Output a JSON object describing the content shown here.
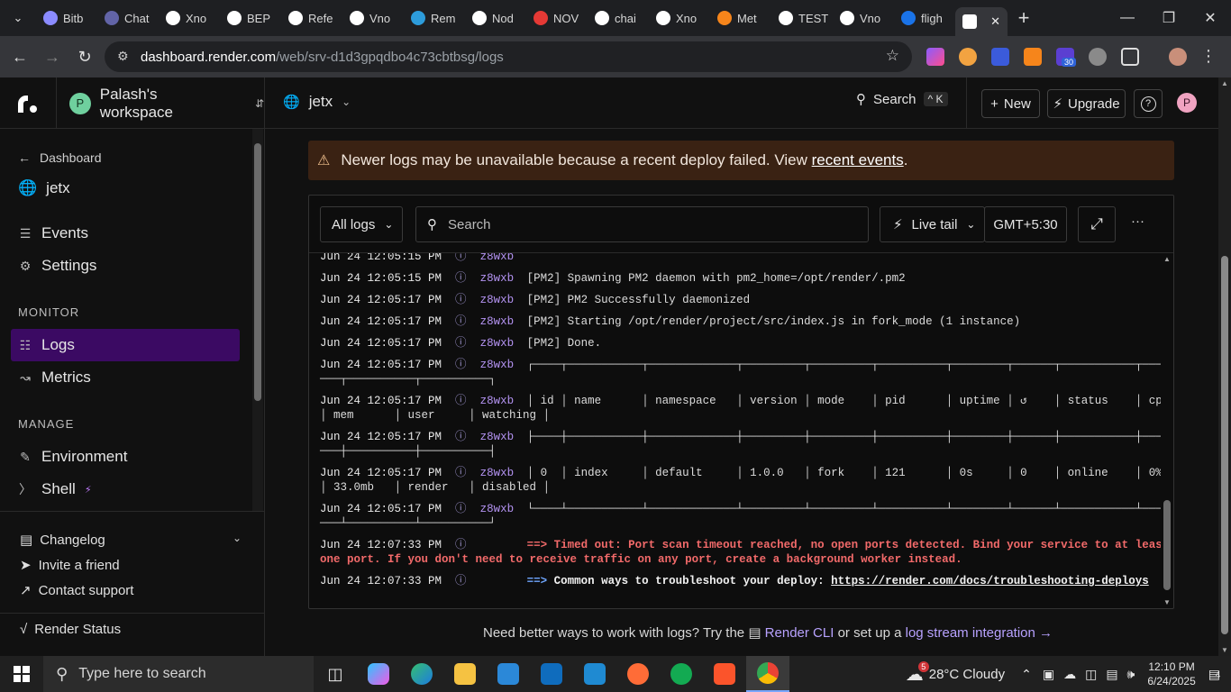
{
  "browser": {
    "tabs": [
      {
        "label": "Bitb",
        "color": "#8b8bff"
      },
      {
        "label": "Chat",
        "color": "#6264a7"
      },
      {
        "label": "Xno",
        "color": "#ffffff"
      },
      {
        "label": "BEP",
        "color": "#ffffff"
      },
      {
        "label": "Refe",
        "color": "#ffffff"
      },
      {
        "label": "Vno",
        "color": "#ffffff"
      },
      {
        "label": "Rem",
        "color": "#2d9cdb"
      },
      {
        "label": "Nod",
        "color": "#ffffff"
      },
      {
        "label": "NOV",
        "color": "#e53935"
      },
      {
        "label": "chai",
        "color": "#ffffff"
      },
      {
        "label": "Xno",
        "color": "#ffffff"
      },
      {
        "label": "Met",
        "color": "#f6851b"
      },
      {
        "label": "TEST",
        "color": "#ffffff"
      },
      {
        "label": "Vno",
        "color": "#ffffff"
      },
      {
        "label": "fligh",
        "color": "#1a73e8"
      }
    ],
    "active_tab_label": "",
    "url_host": "dashboard.render.com",
    "url_path": "/web/srv-d1d3gpqdbo4c73cbtbsg/logs",
    "extension_badge": "30"
  },
  "header": {
    "workspace_initial": "P",
    "workspace_name": "Palash's workspace",
    "project_name": "jetx",
    "search_label": "Search",
    "search_kbd": "^ K",
    "new_label": "New",
    "upgrade_label": "Upgrade",
    "help_label": "?",
    "user_initial": "P"
  },
  "sidebar": {
    "back_label": "Dashboard",
    "service_name": "jetx",
    "items_top": [
      {
        "label": "Events"
      },
      {
        "label": "Settings"
      }
    ],
    "monitor_heading": "MONITOR",
    "monitor_items": [
      {
        "label": "Logs"
      },
      {
        "label": "Metrics"
      }
    ],
    "manage_heading": "MANAGE",
    "manage_items": [
      {
        "label": "Environment"
      },
      {
        "label": "Shell"
      }
    ],
    "bottom": {
      "changelog": "Changelog",
      "invite": "Invite a friend",
      "support": "Contact support",
      "status": "Render Status"
    }
  },
  "main": {
    "warning_text": "Newer logs may be unavailable because a recent deploy failed. View",
    "warning_link": "recent events",
    "warning_end": ".",
    "toolbar": {
      "filter_label": "All logs",
      "search_placeholder": "Search",
      "live_tail_label": "Live tail",
      "timezone_label": "GMT+5:30",
      "more_label": "···"
    },
    "logs": [
      {
        "ts": "Jun 24 12:05:15 PM",
        "inst": "z8wxb",
        "msg": "",
        "cls": ""
      },
      {
        "ts": "Jun 24 12:05:15 PM",
        "inst": "z8wxb",
        "msg": "[PM2] Spawning PM2 daemon with pm2_home=/opt/render/.pm2",
        "cls": ""
      },
      {
        "ts": "Jun 24 12:05:17 PM",
        "inst": "z8wxb",
        "msg": "[PM2] PM2 Successfully daemonized",
        "cls": ""
      },
      {
        "ts": "Jun 24 12:05:17 PM",
        "inst": "z8wxb",
        "msg": "[PM2] Starting /opt/render/project/src/index.js in fork_mode (1 instance)",
        "cls": ""
      },
      {
        "ts": "Jun 24 12:05:17 PM",
        "inst": "z8wxb",
        "msg": "[PM2] Done.",
        "cls": ""
      },
      {
        "ts": "Jun 24 12:05:17 PM",
        "inst": "z8wxb",
        "msg": "┌────┬───────────┬─────────────┬─────────┬─────────┬──────────┬────────┬──────┬───────────┬──────────┬──────",
        "msg2": "───┬──────────┬──────────┐",
        "cls": ""
      },
      {
        "ts": "Jun 24 12:05:17 PM",
        "inst": "z8wxb",
        "msg": "│ id │ name      │ namespace   │ version │ mode    │ pid      │ uptime │ ↺    │ status    │ cpu",
        "msg2": "│ mem      │ user     │ watching │",
        "cls": ""
      },
      {
        "ts": "Jun 24 12:05:17 PM",
        "inst": "z8wxb",
        "msg": "├────┼───────────┼─────────────┼─────────┼─────────┼──────────┼────────┼──────┼───────────┼──────────┼──────",
        "msg2": "───┼──────────┼──────────┤",
        "cls": ""
      },
      {
        "ts": "Jun 24 12:05:17 PM",
        "inst": "z8wxb",
        "msg": "│ 0  │ index     │ default     │ 1.0.0   │ fork    │ 121      │ 0s     │ 0    │ online    │ 0%",
        "msg2": "│ 33.0mb   │ render   │ disabled │",
        "cls": ""
      },
      {
        "ts": "Jun 24 12:05:17 PM",
        "inst": "z8wxb",
        "msg": "└────┴───────────┴─────────────┴─────────┴─────────┴──────────┴────────┴──────┴───────────┴──────────┴──────",
        "msg2": "───┴──────────┴──────────┘",
        "cls": ""
      },
      {
        "ts": "Jun 24 12:07:33 PM",
        "inst": "",
        "msg": "==> Timed out: Port scan timeout reached, no open ports detected. Bind your service to at least",
        "msg2": "one port. If you don't need to receive traffic on any port, create a background worker instead.",
        "cls": "err"
      },
      {
        "ts": "Jun 24 12:07:33 PM",
        "inst": "",
        "msg_arrow": "==>",
        "msg": "Common ways to troubleshoot your deploy: ",
        "msg_link": "https://render.com/docs/troubleshooting-deploys",
        "cls": "tip"
      }
    ],
    "footer": {
      "text1": "Need better ways to work with logs? Try the",
      "cli_link": "Render CLI",
      "text2": "or set up a",
      "stream_link": "log stream integration →"
    }
  },
  "taskbar": {
    "search_placeholder": "Type here to search",
    "weather_badge": "5",
    "weather": "28°C  Cloudy",
    "time": "12:10 PM",
    "date": "6/24/2025",
    "notif_count": "4"
  }
}
